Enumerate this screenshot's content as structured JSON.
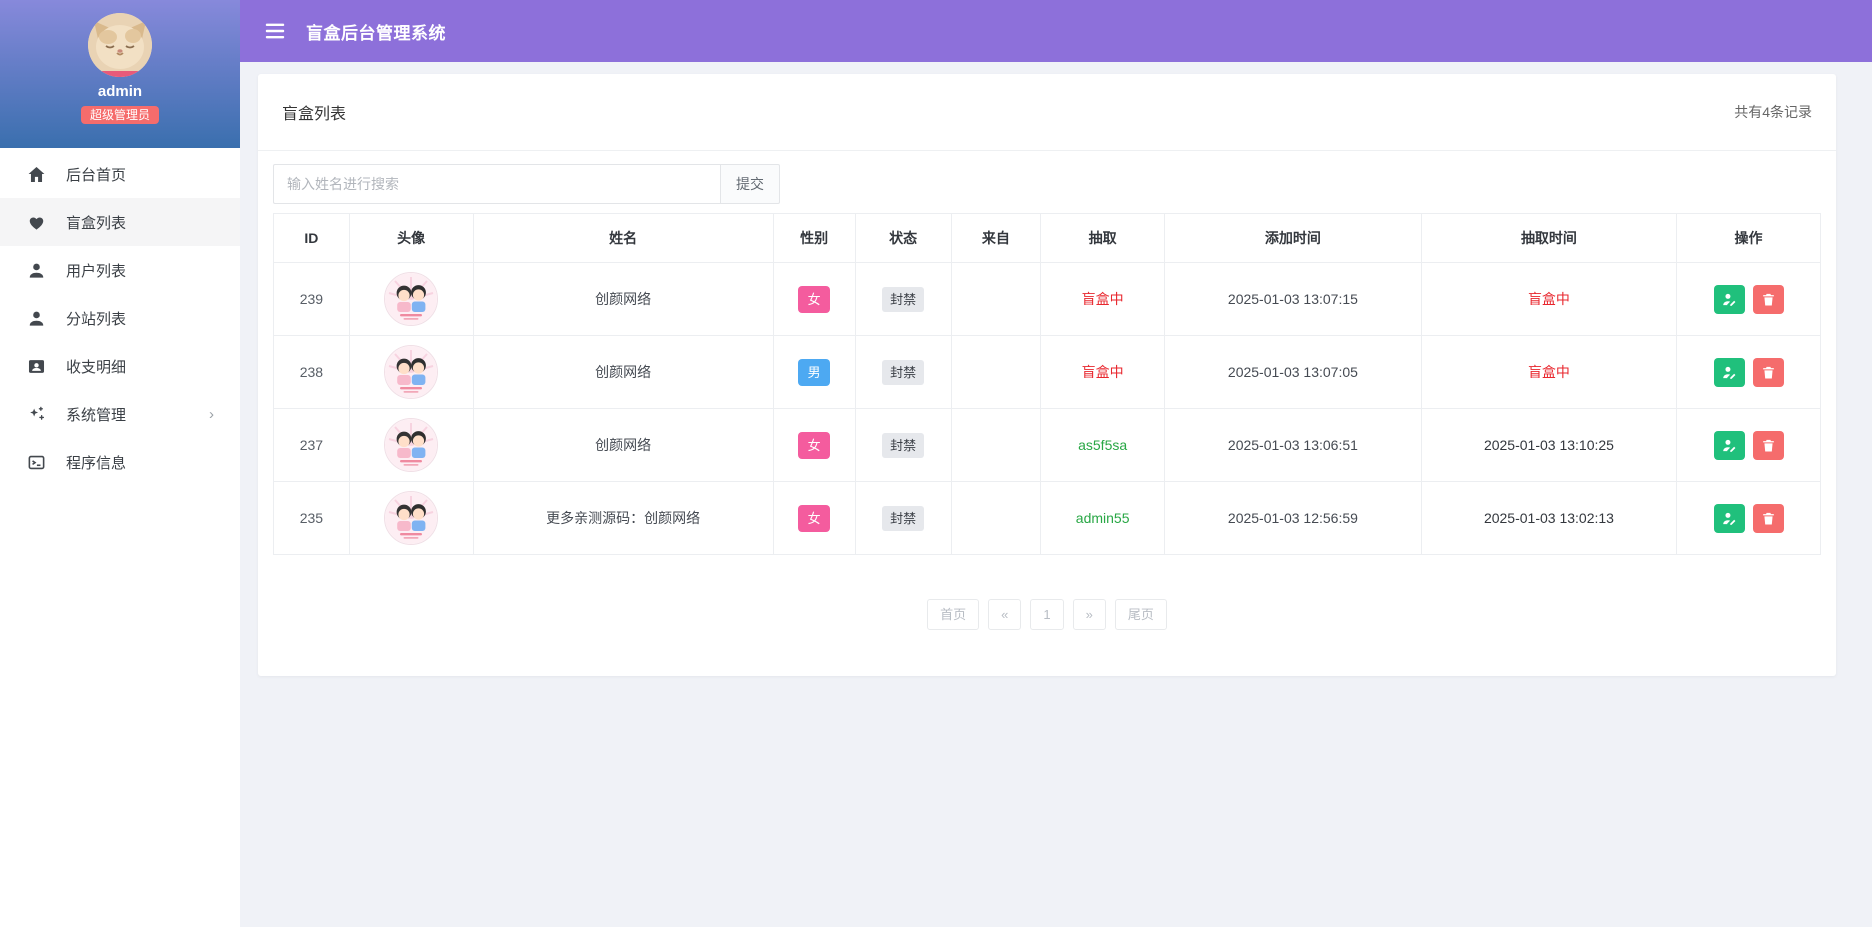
{
  "topbar": {
    "title": "盲盒后台管理系统",
    "menu_icon": "hamburger-icon"
  },
  "sidebar": {
    "username": "admin",
    "role_badge": "超级管理员",
    "items": [
      {
        "label": "后台首页",
        "icon": "home-icon",
        "active": false,
        "has_submenu": false
      },
      {
        "label": "盲盒列表",
        "icon": "heart-icon",
        "active": true,
        "has_submenu": false
      },
      {
        "label": "用户列表",
        "icon": "user-icon",
        "active": false,
        "has_submenu": false
      },
      {
        "label": "分站列表",
        "icon": "user-icon",
        "active": false,
        "has_submenu": false
      },
      {
        "label": "收支明细",
        "icon": "id-card-icon",
        "active": false,
        "has_submenu": false
      },
      {
        "label": "系统管理",
        "icon": "sparkles-icon",
        "active": false,
        "has_submenu": true
      },
      {
        "label": "程序信息",
        "icon": "terminal-icon",
        "active": false,
        "has_submenu": false
      }
    ]
  },
  "main": {
    "card_title": "盲盒列表",
    "record_count": "共有4条记录",
    "search": {
      "placeholder": "输入姓名进行搜索",
      "submit_label": "提交"
    },
    "table": {
      "columns": [
        "ID",
        "头像",
        "姓名",
        "性别",
        "状态",
        "来自",
        "抽取",
        "添加时间",
        "抽取时间",
        "操作"
      ],
      "rows": [
        {
          "id": "239",
          "name": "创颜网络",
          "gender": "女",
          "gender_type": "female",
          "status": "封禁",
          "from": "",
          "draw": "盲盒中",
          "draw_type": "red",
          "added_time": "2025-01-03 13:07:15",
          "draw_time": "盲盒中",
          "draw_time_type": "red"
        },
        {
          "id": "238",
          "name": "创颜网络",
          "gender": "男",
          "gender_type": "male",
          "status": "封禁",
          "from": "",
          "draw": "盲盒中",
          "draw_type": "red",
          "added_time": "2025-01-03 13:07:05",
          "draw_time": "盲盒中",
          "draw_time_type": "red"
        },
        {
          "id": "237",
          "name": "创颜网络",
          "gender": "女",
          "gender_type": "female",
          "status": "封禁",
          "from": "",
          "draw": "as5f5sa",
          "draw_type": "green",
          "added_time": "2025-01-03 13:06:51",
          "draw_time": "2025-01-03 13:10:25",
          "draw_time_type": "normal"
        },
        {
          "id": "235",
          "name": "更多亲测源码：创颜网络",
          "gender": "女",
          "gender_type": "female",
          "status": "封禁",
          "from": "",
          "draw": "admin55",
          "draw_type": "green",
          "added_time": "2025-01-03 12:56:59",
          "draw_time": "2025-01-03 13:02:13",
          "draw_time_type": "normal"
        }
      ]
    },
    "pagination": [
      "首页",
      "«",
      "1",
      "»",
      "尾页"
    ]
  },
  "colors": {
    "topbar_purple": "#8d70da",
    "sidebar_gradient_top": "#8789db",
    "sidebar_gradient_bottom": "#3a6fae",
    "role_badge_red": "#f56c6c",
    "female_pink": "#f45c9e",
    "male_blue": "#4da9f2",
    "status_gray": "#e6e8ec",
    "draw_red_text": "#e8262d",
    "draw_green_text": "#28a745",
    "edit_button_green": "#20c07c",
    "delete_button_red": "#f56c6c",
    "page_background": "#f0f2f7"
  }
}
